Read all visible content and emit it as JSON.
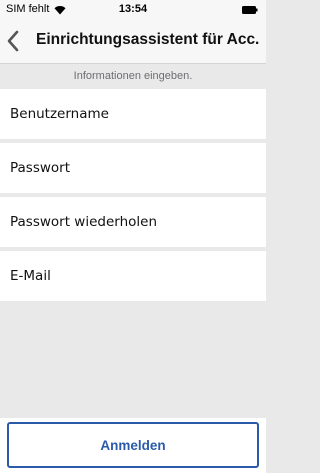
{
  "status_bar": {
    "carrier": "SIM fehlt",
    "wifi_icon": "wifi-icon",
    "time": "13:54",
    "battery_icon": "battery-icon"
  },
  "nav": {
    "back_icon": "chevron-left-icon",
    "title": "Einrichtungsassistent für Acc..."
  },
  "form": {
    "hint": "Informationen eingeben.",
    "username_placeholder": "Benutzername",
    "password_placeholder": "Passwort",
    "password_repeat_placeholder": "Passwort wiederholen",
    "email_placeholder": "E-Mail"
  },
  "footer": {
    "login_label": "Anmelden"
  },
  "colors": {
    "accent": "#2a5aa8",
    "background": "#e9e9e9"
  }
}
